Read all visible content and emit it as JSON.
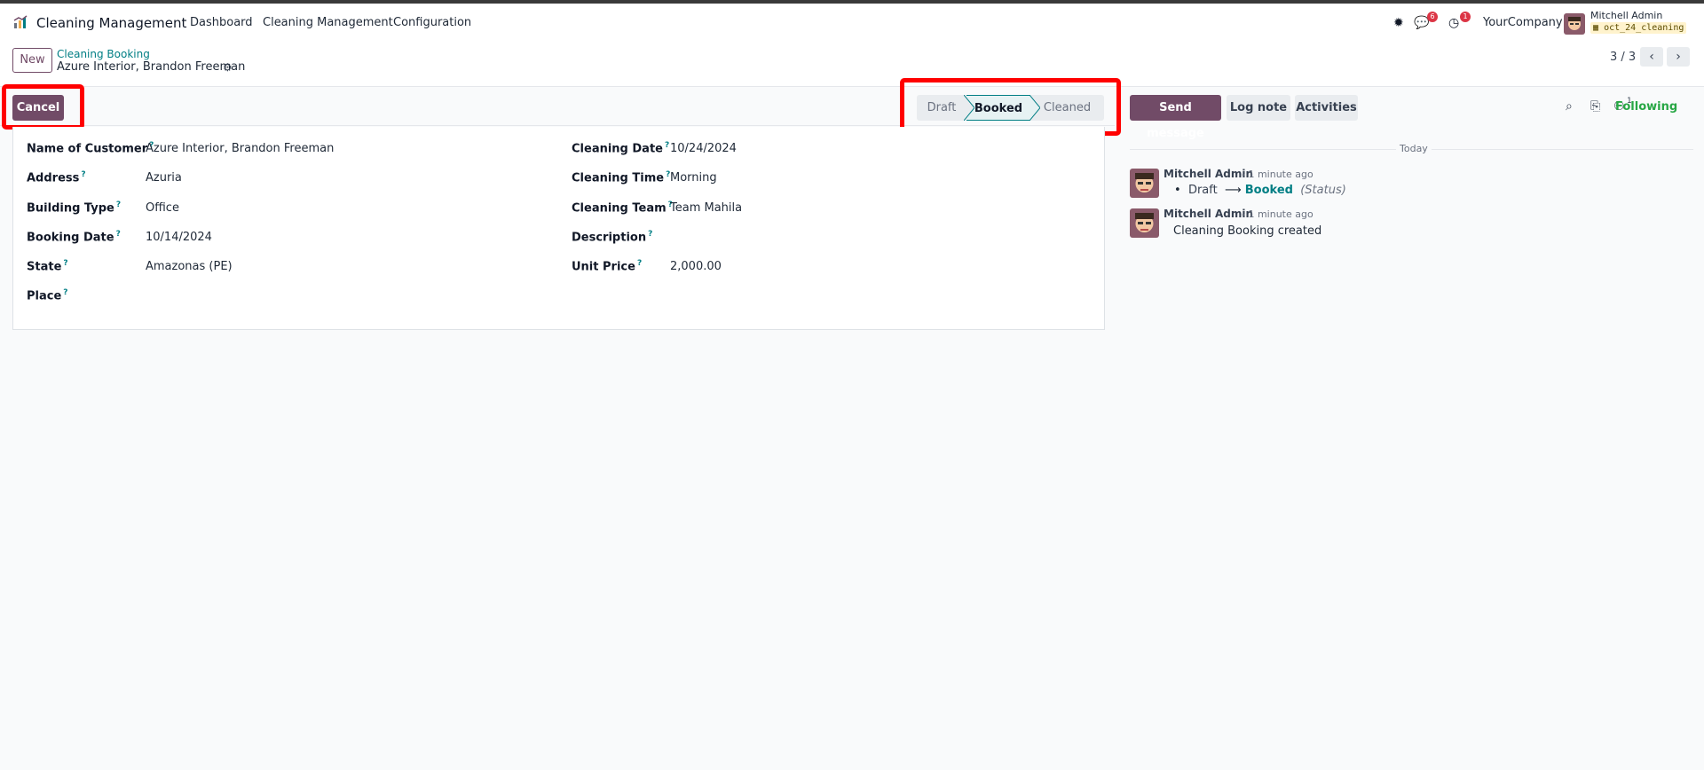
{
  "navbar": {
    "app_name": "Cleaning Management",
    "menus": [
      "Dashboard",
      "Cleaning Management",
      "Configuration"
    ],
    "messages_count": "6",
    "activities_count": "1",
    "company": "YourCompany",
    "user_name": "Mitchell Admin",
    "database": "oct_24_cleaning"
  },
  "control": {
    "new_label": "New",
    "breadcrumb_parent": "Cleaning Booking",
    "breadcrumb_current": "Azure Interior, Brandon Freeman",
    "pager": "3 / 3"
  },
  "statusbar": {
    "cancel_label": "Cancel",
    "stages": [
      "Draft",
      "Booked",
      "Cleaned"
    ],
    "active_stage": "Booked"
  },
  "form": {
    "left": [
      {
        "label": "Name of Customer",
        "value": "Azure Interior, Brandon Freeman"
      },
      {
        "label": "Address",
        "value": "Azuria"
      },
      {
        "label": "Building Type",
        "value": "Office"
      },
      {
        "label": "Booking Date",
        "value": "10/14/2024"
      },
      {
        "label": "State",
        "value": "Amazonas (PE)"
      },
      {
        "label": "Place",
        "value": ""
      }
    ],
    "right": [
      {
        "label": "Cleaning Date",
        "value": "10/24/2024"
      },
      {
        "label": "Cleaning Time",
        "value": "Morning"
      },
      {
        "label": "Cleaning Team",
        "value": "Team Mahila"
      },
      {
        "label": "Description",
        "value": ""
      },
      {
        "label": "Unit Price",
        "value": "2,000.00"
      }
    ],
    "help_marker": "?"
  },
  "chatter": {
    "send_message": "Send message",
    "log_note": "Log note",
    "activities": "Activities",
    "followers_count": "1",
    "following": "Following",
    "date_separator": "Today",
    "messages": [
      {
        "author": "Mitchell Admin",
        "time": "- 1 minute ago",
        "old_value": "Draft",
        "new_value": "Booked",
        "field": "(Status)"
      },
      {
        "author": "Mitchell Admin",
        "time": "- 1 minute ago",
        "body": "Cleaning Booking created"
      }
    ]
  },
  "colors": {
    "brand": "#714b67",
    "link": "#017e84",
    "following": "#28a745",
    "highlight": "#ff0000"
  }
}
